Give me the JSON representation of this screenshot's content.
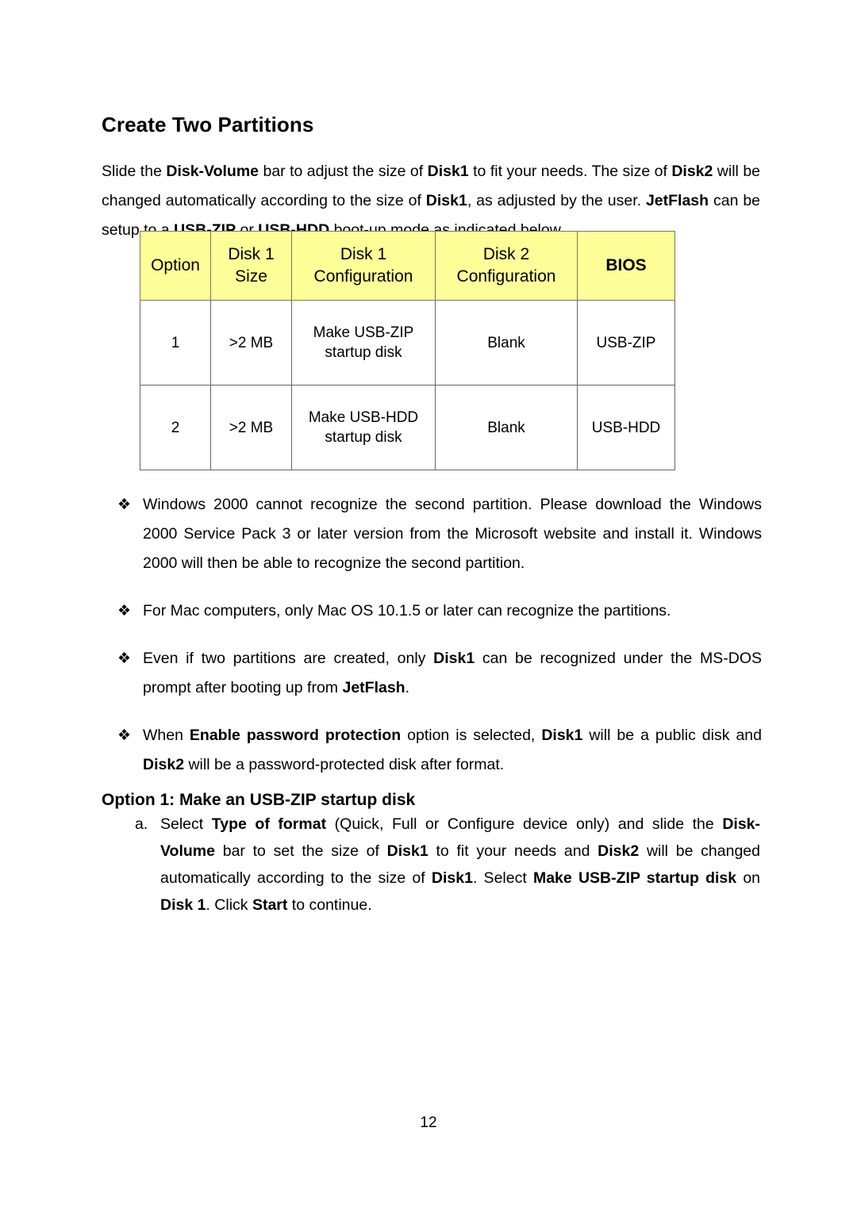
{
  "page": {
    "heading": "Create Two Partitions",
    "page_number": "12"
  },
  "intro": {
    "segments": [
      {
        "t": "Slide the ",
        "b": false
      },
      {
        "t": "Disk-Volume",
        "b": true
      },
      {
        "t": " bar to adjust the size of ",
        "b": false
      },
      {
        "t": "Disk1",
        "b": true
      },
      {
        "t": " to fit your needs. The size of ",
        "b": false
      },
      {
        "t": "Disk2",
        "b": true
      },
      {
        "t": " will be changed automatically according to the size of ",
        "b": false
      },
      {
        "t": "Disk1",
        "b": true
      },
      {
        "t": ", as adjusted by the user. ",
        "b": false
      },
      {
        "t": "JetFlash",
        "b": true
      },
      {
        "t": " can be setup to a ",
        "b": false
      },
      {
        "t": "USB-ZIP",
        "b": true
      },
      {
        "t": " or ",
        "b": false
      },
      {
        "t": "USB-HDD",
        "b": true
      },
      {
        "t": " boot-up mode as indicated below.",
        "b": false
      }
    ]
  },
  "table": {
    "headers": [
      "Option",
      "Disk 1\nSize",
      "Disk 1\nConfiguration",
      "Disk 2\nConfiguration",
      "BIOS"
    ],
    "header_bg": "#ffff99",
    "border_color": "#666666",
    "rows": [
      {
        "option": "1",
        "disk1_size": ">2 MB",
        "disk1_config": "Make USB-ZIP\nstartup disk",
        "disk2_config": "Blank",
        "bios": "USB-ZIP"
      },
      {
        "option": "2",
        "disk1_size": ">2 MB",
        "disk1_config": "Make USB-HDD\nstartup disk",
        "disk2_config": "Blank",
        "bios": "USB-HDD"
      }
    ]
  },
  "notes": {
    "bullet_glyph": "❖",
    "items": [
      {
        "segments": [
          {
            "t": "Windows 2000 cannot recognize the second partition. Please download the Windows 2000 Service Pack 3 or later version from the Microsoft website and install it. Windows 2000 will then be able to recognize the second partition.",
            "b": false
          }
        ]
      },
      {
        "segments": [
          {
            "t": "For Mac computers, only Mac OS 10.1.5 or later can recognize the partitions.",
            "b": false
          }
        ]
      },
      {
        "segments": [
          {
            "t": "Even if two partitions are created, only ",
            "b": false
          },
          {
            "t": "Disk1",
            "b": true
          },
          {
            "t": " can be recognized under the MS-DOS prompt after booting up from ",
            "b": false
          },
          {
            "t": "JetFlash",
            "b": true
          },
          {
            "t": ".",
            "b": false
          }
        ]
      },
      {
        "segments": [
          {
            "t": "When ",
            "b": false
          },
          {
            "t": "Enable password protection",
            "b": true
          },
          {
            "t": " option is selected, ",
            "b": false
          },
          {
            "t": "Disk1",
            "b": true
          },
          {
            "t": " will be a public disk and ",
            "b": false
          },
          {
            "t": "Disk2",
            "b": true
          },
          {
            "t": " will be a password-protected disk after format.",
            "b": false
          }
        ]
      }
    ]
  },
  "option_section": {
    "heading": "Option 1: Make an USB-ZIP startup disk",
    "steps": [
      {
        "marker": "a.",
        "segments": [
          {
            "t": "Select ",
            "b": false
          },
          {
            "t": "Type of format",
            "b": true
          },
          {
            "t": " (Quick, Full or Configure device only) and slide the ",
            "b": false
          },
          {
            "t": "Disk-Volume",
            "b": true
          },
          {
            "t": " bar to set the size of ",
            "b": false
          },
          {
            "t": "Disk1",
            "b": true
          },
          {
            "t": " to fit your needs and ",
            "b": false
          },
          {
            "t": "Disk2",
            "b": true
          },
          {
            "t": " will be changed automatically according to the size of ",
            "b": false
          },
          {
            "t": "Disk1",
            "b": true
          },
          {
            "t": ". Select ",
            "b": false
          },
          {
            "t": "Make USB-ZIP startup disk",
            "b": true
          },
          {
            "t": " on ",
            "b": false
          },
          {
            "t": "Disk 1",
            "b": true
          },
          {
            "t": ". Click ",
            "b": false
          },
          {
            "t": "Start",
            "b": true
          },
          {
            "t": " to continue.",
            "b": false
          }
        ]
      }
    ]
  }
}
